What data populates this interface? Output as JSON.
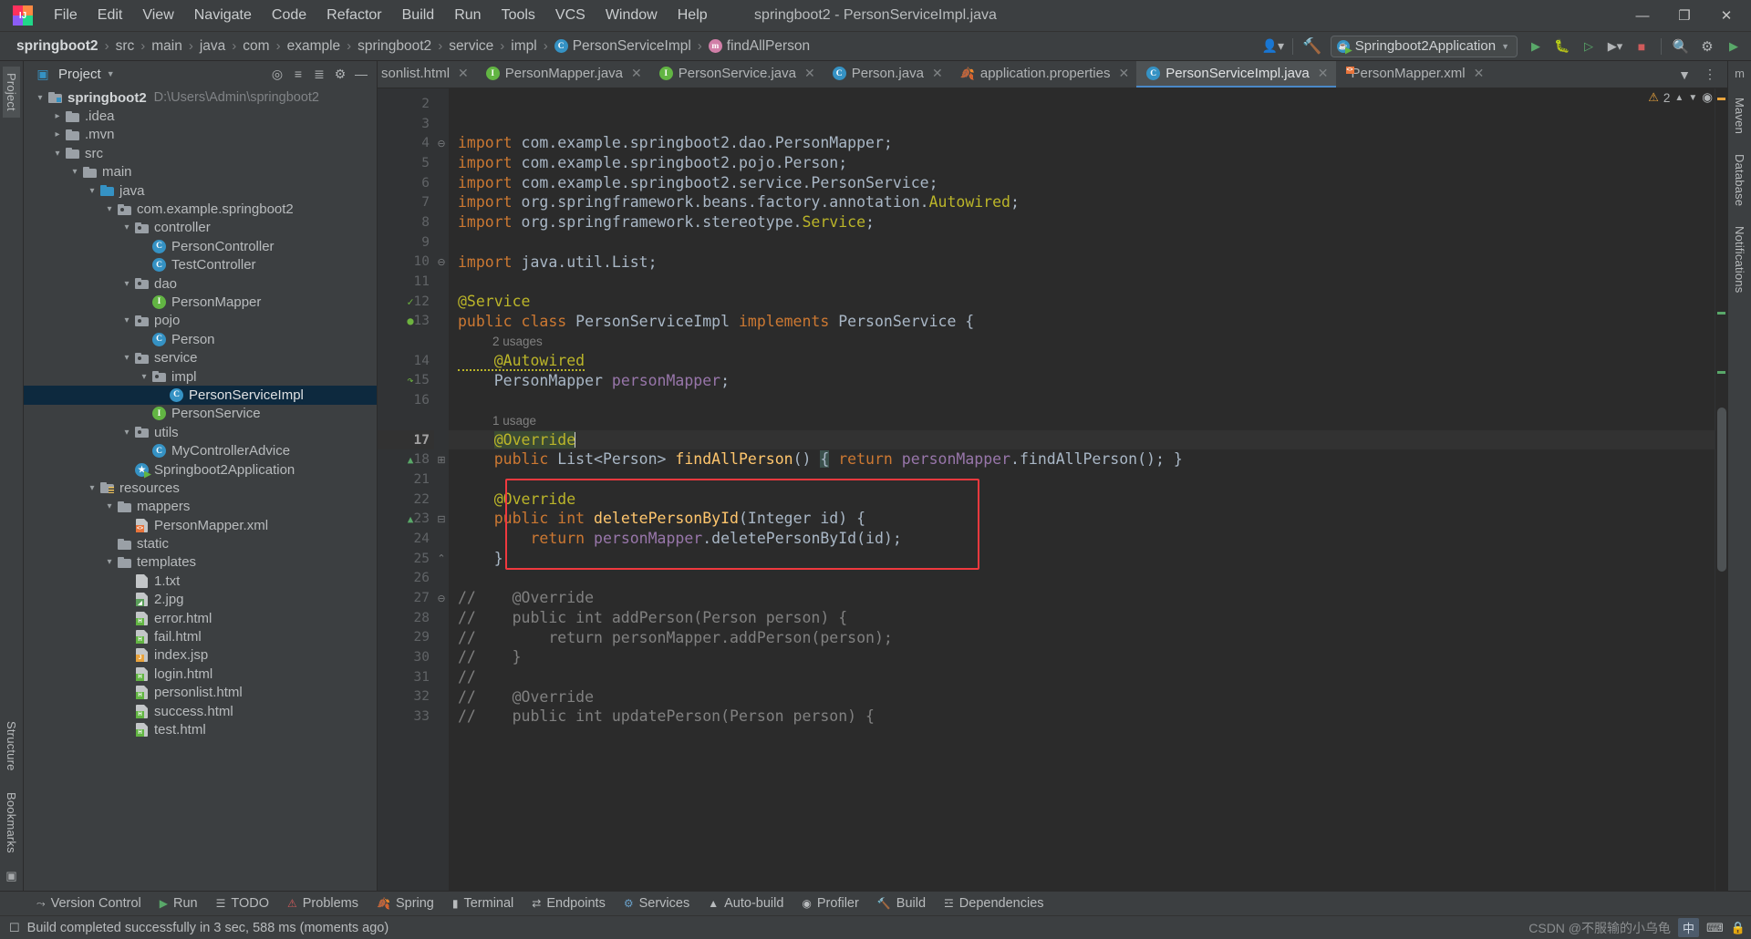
{
  "window": {
    "title": "springboot2 - PersonServiceImpl.java",
    "logo_text": "IJ",
    "minimize": "—",
    "maximize": "❐",
    "close": "✕"
  },
  "menu": {
    "items": [
      {
        "label": "File"
      },
      {
        "label": "Edit"
      },
      {
        "label": "View"
      },
      {
        "label": "Navigate"
      },
      {
        "label": "Code"
      },
      {
        "label": "Refactor"
      },
      {
        "label": "Build"
      },
      {
        "label": "Run"
      },
      {
        "label": "Tools"
      },
      {
        "label": "VCS"
      },
      {
        "label": "Window"
      },
      {
        "label": "Help"
      }
    ]
  },
  "navbar": {
    "breadcrumb": [
      {
        "label": "springboot2",
        "icon": "",
        "bold": true
      },
      {
        "label": "src",
        "icon": ""
      },
      {
        "label": "main",
        "icon": ""
      },
      {
        "label": "java",
        "icon": ""
      },
      {
        "label": "com",
        "icon": ""
      },
      {
        "label": "example",
        "icon": ""
      },
      {
        "label": "springboot2",
        "icon": ""
      },
      {
        "label": "service",
        "icon": ""
      },
      {
        "label": "impl",
        "icon": ""
      },
      {
        "label": "PersonServiceImpl",
        "icon": "class-badge"
      },
      {
        "label": "findAllPerson",
        "icon": "method-badge"
      }
    ],
    "separator": "›",
    "run_config": "Springboot2Application",
    "icons": {
      "user": "user-icon",
      "hammer": "build-hammer-icon",
      "run": "run-icon",
      "debug": "debug-icon",
      "coverage": "coverage-icon",
      "more_run": "run-more-icon",
      "stop": "stop-icon",
      "search": "search-icon",
      "settings": "gear-icon",
      "updates": "updates-icon"
    }
  },
  "left_rail": {
    "top": [
      {
        "label": "Project",
        "active": true
      }
    ],
    "bottom": [
      {
        "label": "Bookmarks"
      },
      {
        "label": "Structure"
      }
    ]
  },
  "right_rail": {
    "items": [
      {
        "label": "Maven"
      },
      {
        "label": "Database"
      },
      {
        "label": "Notifications"
      }
    ]
  },
  "project_panel": {
    "title": "Project",
    "icons": {
      "panel": "project-panel-icon",
      "dropdown": "chevron-down-icon",
      "locate": "locate-file-icon",
      "expand": "expand-all-icon",
      "collapse": "collapse-all-icon",
      "settings": "gear-icon",
      "hide": "hide-panel-icon"
    },
    "tree": [
      {
        "indent": 0,
        "arrow": "v",
        "icon": "folder-module",
        "label": "springboot2",
        "bold": true,
        "path": "D:\\Users\\Admin\\springboot2"
      },
      {
        "indent": 1,
        "arrow": ">",
        "icon": "folder",
        "label": ".idea"
      },
      {
        "indent": 1,
        "arrow": ">",
        "icon": "folder",
        "label": ".mvn"
      },
      {
        "indent": 1,
        "arrow": "v",
        "icon": "folder",
        "label": "src"
      },
      {
        "indent": 2,
        "arrow": "v",
        "icon": "folder",
        "label": "main"
      },
      {
        "indent": 3,
        "arrow": "v",
        "icon": "folder-source",
        "label": "java"
      },
      {
        "indent": 4,
        "arrow": "v",
        "icon": "folder-package",
        "label": "com.example.springboot2"
      },
      {
        "indent": 5,
        "arrow": "v",
        "icon": "folder-package",
        "label": "controller"
      },
      {
        "indent": 6,
        "arrow": "",
        "icon": "class-badge",
        "label": "PersonController"
      },
      {
        "indent": 6,
        "arrow": "",
        "icon": "class-badge",
        "label": "TestController"
      },
      {
        "indent": 5,
        "arrow": "v",
        "icon": "folder-package",
        "label": "dao"
      },
      {
        "indent": 6,
        "arrow": "",
        "icon": "interface-badge",
        "label": "PersonMapper"
      },
      {
        "indent": 5,
        "arrow": "v",
        "icon": "folder-package",
        "label": "pojo"
      },
      {
        "indent": 6,
        "arrow": "",
        "icon": "class-badge",
        "label": "Person"
      },
      {
        "indent": 5,
        "arrow": "v",
        "icon": "folder-package",
        "label": "service"
      },
      {
        "indent": 6,
        "arrow": "v",
        "icon": "folder-package",
        "label": "impl"
      },
      {
        "indent": 7,
        "arrow": "",
        "icon": "class-badge",
        "label": "PersonServiceImpl",
        "selected": true
      },
      {
        "indent": 6,
        "arrow": "",
        "icon": "interface-badge",
        "label": "PersonService"
      },
      {
        "indent": 5,
        "arrow": "v",
        "icon": "folder-package",
        "label": "utils"
      },
      {
        "indent": 6,
        "arrow": "",
        "icon": "class-badge",
        "label": "MyControllerAdvice"
      },
      {
        "indent": 5,
        "arrow": "",
        "icon": "spring-boot-badge",
        "label": "Springboot2Application"
      },
      {
        "indent": 3,
        "arrow": "v",
        "icon": "folder-resources",
        "label": "resources"
      },
      {
        "indent": 4,
        "arrow": "v",
        "icon": "folder",
        "label": "mappers"
      },
      {
        "indent": 5,
        "arrow": "",
        "icon": "file-xml",
        "label": "PersonMapper.xml"
      },
      {
        "indent": 4,
        "arrow": "",
        "icon": "folder",
        "label": "static"
      },
      {
        "indent": 4,
        "arrow": "v",
        "icon": "folder",
        "label": "templates"
      },
      {
        "indent": 5,
        "arrow": "",
        "icon": "file-txt",
        "label": "1.txt"
      },
      {
        "indent": 5,
        "arrow": "",
        "icon": "file-img",
        "label": "2.jpg"
      },
      {
        "indent": 5,
        "arrow": "",
        "icon": "file-html",
        "label": "error.html"
      },
      {
        "indent": 5,
        "arrow": "",
        "icon": "file-html",
        "label": "fail.html"
      },
      {
        "indent": 5,
        "arrow": "",
        "icon": "file-jsp",
        "label": "index.jsp"
      },
      {
        "indent": 5,
        "arrow": "",
        "icon": "file-html",
        "label": "login.html"
      },
      {
        "indent": 5,
        "arrow": "",
        "icon": "file-html",
        "label": "personlist.html"
      },
      {
        "indent": 5,
        "arrow": "",
        "icon": "file-html",
        "label": "success.html"
      },
      {
        "indent": 5,
        "arrow": "",
        "icon": "file-html",
        "label": "test.html"
      }
    ]
  },
  "editor": {
    "tabs": [
      {
        "label": "sonlist.html",
        "icon": "file-html",
        "active": false,
        "truncated": true
      },
      {
        "label": "PersonMapper.java",
        "icon": "interface-badge",
        "active": false
      },
      {
        "label": "PersonService.java",
        "icon": "interface-badge",
        "active": false
      },
      {
        "label": "Person.java",
        "icon": "class-badge",
        "active": false
      },
      {
        "label": "application.properties",
        "icon": "spring-leaf",
        "active": false
      },
      {
        "label": "PersonServiceImpl.java",
        "icon": "class-badge",
        "active": true
      },
      {
        "label": "PersonMapper.xml",
        "icon": "file-xml",
        "active": false
      }
    ],
    "tabs_overflow_icon": "chevron-down-icon",
    "tabs_more_icon": "more-options-icon",
    "inspection": {
      "warning_count": "2",
      "warning_icon": "warning-triangle-icon",
      "prev_icon": "chevron-up-icon",
      "next_icon": "chevron-down-icon",
      "eye_icon": "inspection-eye-icon"
    },
    "lines": [
      {
        "num": "2",
        "segments": []
      },
      {
        "num": "3",
        "segments": []
      },
      {
        "num": "4",
        "fold": "⊖",
        "segments": [
          {
            "t": "import ",
            "c": "kw"
          },
          {
            "t": "com.example.springboot2.dao.PersonMapper;",
            "c": "typ"
          }
        ]
      },
      {
        "num": "5",
        "segments": [
          {
            "t": "import ",
            "c": "kw"
          },
          {
            "t": "com.example.springboot2.pojo.Person;",
            "c": "typ"
          }
        ]
      },
      {
        "num": "6",
        "segments": [
          {
            "t": "import ",
            "c": "kw"
          },
          {
            "t": "com.example.springboot2.service.PersonService;",
            "c": "typ"
          }
        ]
      },
      {
        "num": "7",
        "segments": [
          {
            "t": "import ",
            "c": "kw"
          },
          {
            "t": "org.springframework.beans.factory.annotation.",
            "c": "typ"
          },
          {
            "t": "Autowired",
            "c": "ann"
          },
          {
            "t": ";",
            "c": "typ"
          }
        ]
      },
      {
        "num": "8",
        "segments": [
          {
            "t": "import ",
            "c": "kw"
          },
          {
            "t": "org.springframework.stereotype.",
            "c": "typ"
          },
          {
            "t": "Service",
            "c": "ann"
          },
          {
            "t": ";",
            "c": "typ"
          }
        ]
      },
      {
        "num": "9",
        "segments": []
      },
      {
        "num": "10",
        "fold": "⊖",
        "segments": [
          {
            "t": "import ",
            "c": "kw"
          },
          {
            "t": "java.util.List;",
            "c": "typ"
          }
        ]
      },
      {
        "num": "11",
        "segments": []
      },
      {
        "num": "12",
        "gmark": "spring-bean-icon",
        "segments": [
          {
            "t": "@Service",
            "c": "ann"
          }
        ]
      },
      {
        "num": "13",
        "gmark": "spring-bean-impl-icon",
        "segments": [
          {
            "t": "public class ",
            "c": "kw"
          },
          {
            "t": "PersonServiceImpl ",
            "c": "typ"
          },
          {
            "t": "implements ",
            "c": "kw"
          },
          {
            "t": "PersonService",
            "c": "typ"
          },
          {
            "t": " {",
            "c": "typ"
          }
        ]
      },
      {
        "num": "",
        "hint": "2 usages"
      },
      {
        "num": "14",
        "segments": [
          {
            "t": "    @Autowired",
            "c": "ann squig"
          }
        ]
      },
      {
        "num": "15",
        "gmark": "navigate-impl-icon",
        "segments": [
          {
            "t": "    PersonMapper ",
            "c": "typ"
          },
          {
            "t": "personMapper",
            "c": "fld"
          },
          {
            "t": ";",
            "c": "typ"
          }
        ]
      },
      {
        "num": "16",
        "segments": []
      },
      {
        "num": "",
        "hint": "1 usage"
      },
      {
        "num": "17",
        "current": true,
        "segments": [
          {
            "t": "    ",
            "c": "typ"
          },
          {
            "t": "@Override",
            "c": "ann sel-green"
          },
          {
            "t": "|",
            "c": "caret"
          }
        ]
      },
      {
        "num": "18",
        "gmark": "override-icon",
        "fold": "⊞",
        "segments": [
          {
            "t": "    public ",
            "c": "kw"
          },
          {
            "t": "List<Person> ",
            "c": "typ"
          },
          {
            "t": "findAllPerson",
            "c": "mth"
          },
          {
            "t": "() ",
            "c": "typ"
          },
          {
            "t": "{",
            "c": "typ brace-hl"
          },
          {
            "t": " return ",
            "c": "kw"
          },
          {
            "t": "personMapper",
            "c": "fld"
          },
          {
            "t": ".",
            "c": "typ"
          },
          {
            "t": "findAllPerson",
            "c": "typ"
          },
          {
            "t": "(); }",
            "c": "typ"
          }
        ]
      },
      {
        "num": "21",
        "segments": []
      },
      {
        "num": "22",
        "segments": [
          {
            "t": "    ",
            "c": "typ"
          },
          {
            "t": "@Override",
            "c": "ann"
          }
        ]
      },
      {
        "num": "23",
        "gmark": "override-icon",
        "fold": "⊟",
        "segments": [
          {
            "t": "    public int ",
            "c": "kw"
          },
          {
            "t": "deletePersonById",
            "c": "mth"
          },
          {
            "t": "(Integer ",
            "c": "typ"
          },
          {
            "t": "id",
            "c": "typ"
          },
          {
            "t": ") {",
            "c": "typ"
          }
        ]
      },
      {
        "num": "24",
        "segments": [
          {
            "t": "        return ",
            "c": "kw"
          },
          {
            "t": "personMapper",
            "c": "fld"
          },
          {
            "t": ".deletePersonById(id);",
            "c": "typ"
          }
        ]
      },
      {
        "num": "25",
        "fold": "⌃",
        "segments": [
          {
            "t": "    }",
            "c": "typ"
          }
        ]
      },
      {
        "num": "26",
        "segments": []
      },
      {
        "num": "27",
        "fold": "⊖",
        "segments": [
          {
            "t": "//    @Override",
            "c": "cmt"
          }
        ]
      },
      {
        "num": "28",
        "segments": [
          {
            "t": "//    public int addPerson(Person person) {",
            "c": "cmt"
          }
        ]
      },
      {
        "num": "29",
        "segments": [
          {
            "t": "//        return personMapper.addPerson(person);",
            "c": "cmt"
          }
        ]
      },
      {
        "num": "30",
        "segments": [
          {
            "t": "//    }",
            "c": "cmt"
          }
        ]
      },
      {
        "num": "31",
        "segments": [
          {
            "t": "//",
            "c": "cmt"
          }
        ]
      },
      {
        "num": "32",
        "segments": [
          {
            "t": "//    @Override",
            "c": "cmt"
          }
        ]
      },
      {
        "num": "33",
        "segments": [
          {
            "t": "//    public int updatePerson(Person person) {",
            "c": "cmt"
          }
        ]
      }
    ],
    "highlight_box": {
      "label": "delete-method-highlight"
    }
  },
  "tool_strip": {
    "items": [
      {
        "label": "Version Control",
        "icon": "version-control-icon"
      },
      {
        "label": "Run",
        "icon": "run-icon"
      },
      {
        "label": "TODO",
        "icon": "todo-icon"
      },
      {
        "label": "Problems",
        "icon": "problems-icon"
      },
      {
        "label": "Spring",
        "icon": "spring-icon"
      },
      {
        "label": "Terminal",
        "icon": "terminal-icon"
      },
      {
        "label": "Endpoints",
        "icon": "endpoints-icon"
      },
      {
        "label": "Services",
        "icon": "services-icon"
      },
      {
        "label": "Auto-build",
        "icon": "auto-build-icon"
      },
      {
        "label": "Profiler",
        "icon": "profiler-icon"
      },
      {
        "label": "Build",
        "icon": "build-icon"
      },
      {
        "label": "Dependencies",
        "icon": "dependencies-icon"
      }
    ]
  },
  "statusbar": {
    "message": "Build completed successfully in 3 sec, 588 ms (moments ago)",
    "event_icon": "event-log-icon",
    "watermark": "CSDN @不服输的小乌龟",
    "ime_chip": "中",
    "right_icons": [
      "ime-icon",
      "keyboard-icon",
      "lock-icon"
    ]
  },
  "colors": {
    "accent": "#4a88c7",
    "selection": "#0d293e",
    "highlight_box": "#f0393e",
    "keyword": "#cc7832",
    "annotation": "#bbb529",
    "method": "#ffc66d",
    "field": "#9876aa",
    "comment": "#808080",
    "editor_bg": "#2b2b2b",
    "panel_bg": "#3c3f41"
  }
}
